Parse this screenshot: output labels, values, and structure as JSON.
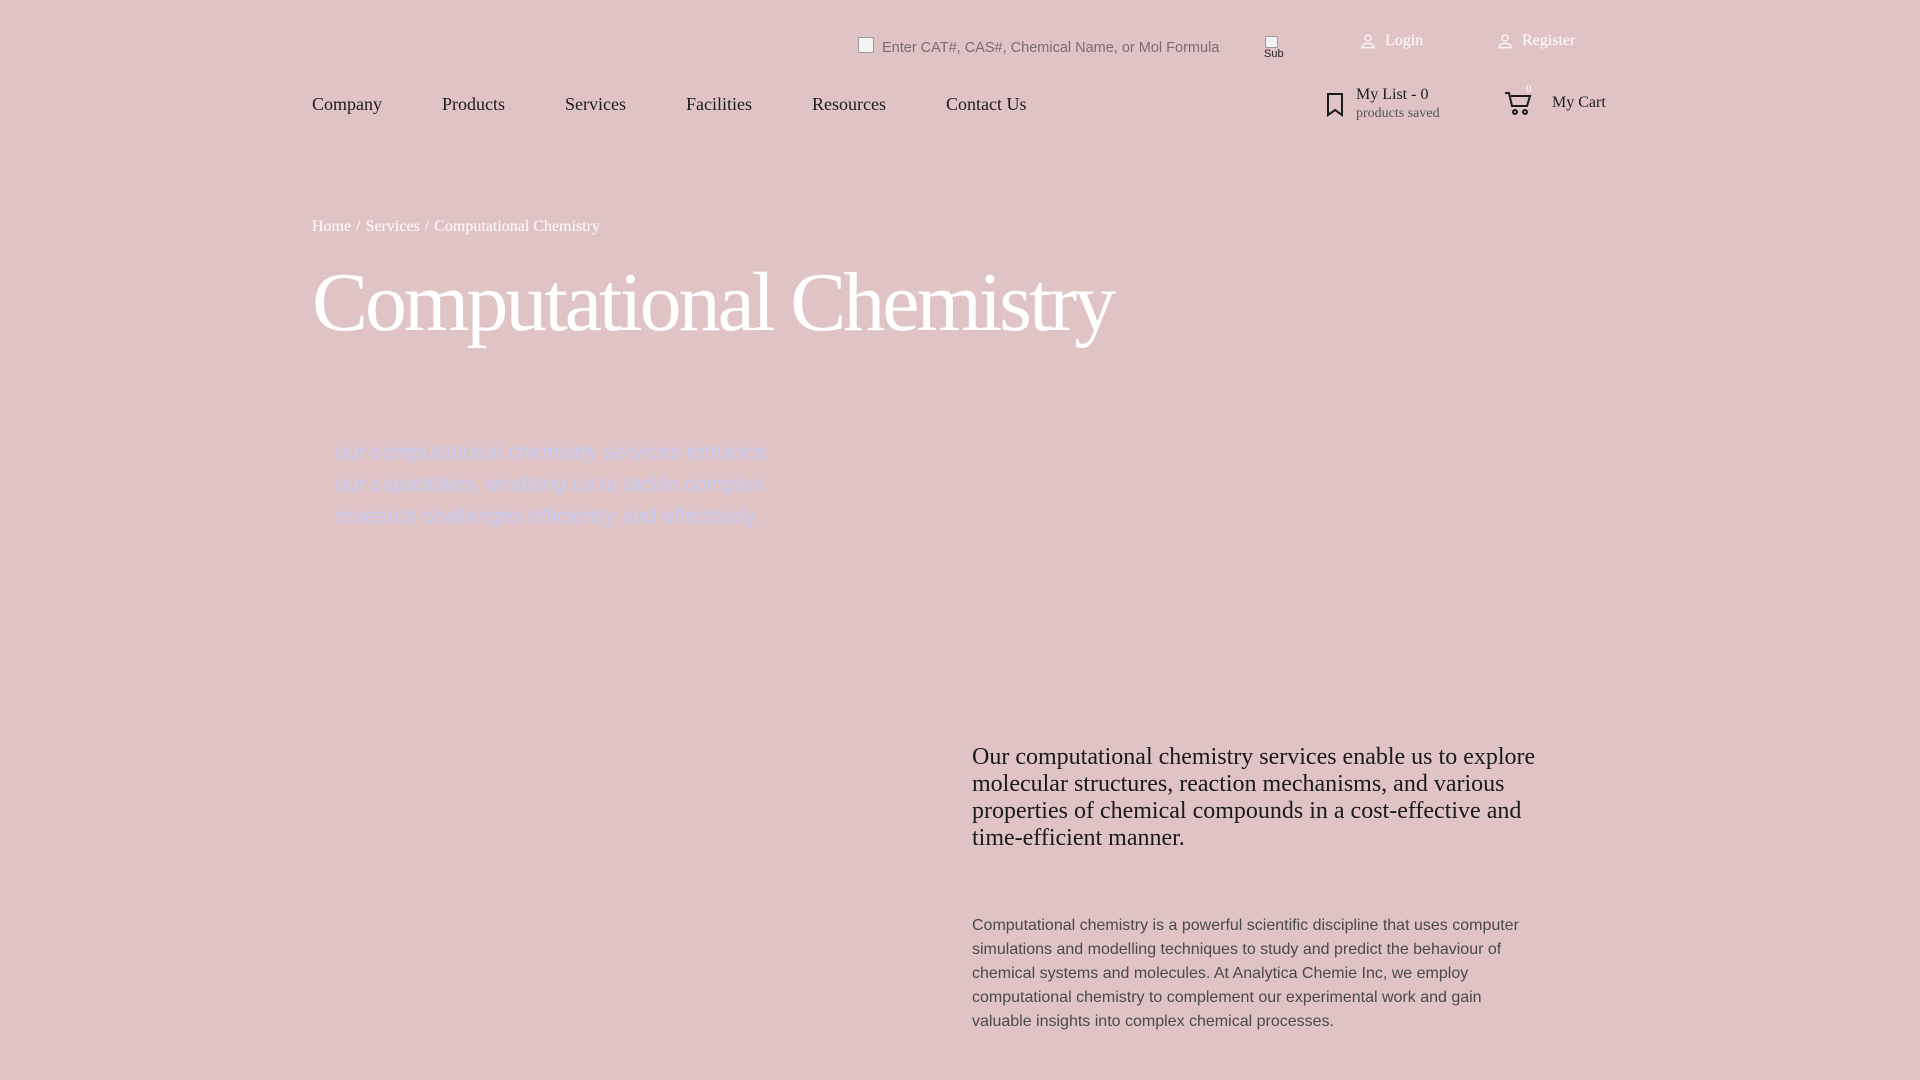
{
  "header": {
    "search": {
      "placeholder": "Enter CAT#, CAS#, Chemical Name, or Mol Formula",
      "value": ""
    },
    "submit_alt": "Sub",
    "login_label": "Login",
    "register_label": "Register"
  },
  "nav": {
    "items": [
      "Company",
      "Products",
      "Services",
      "Facilities",
      "Resources",
      "Contact Us"
    ]
  },
  "my_list": {
    "title": "My List - 0",
    "subtitle": "products saved"
  },
  "cart": {
    "label": "My Cart",
    "count": "0"
  },
  "breadcrumb": {
    "home": "Home",
    "sep": "/",
    "services": "Services",
    "current": "Computational Chemistry"
  },
  "page": {
    "title": "Computational Chemistry",
    "blurb": "our computational chemistry services enhance our capabilities, enabling us to tackle complex research challenges efficiently and effectively.",
    "lead": "Our computational chemistry services enable us to explore molecular structures, reaction mechanisms, and various properties of chemical compounds in a cost-effective and time-efficient manner.",
    "body": "Computational chemistry is a powerful scientific discipline that uses computer simulations and modelling techniques to study and predict the behaviour of chemical systems and molecules. At Analytica Chemie Inc, we employ computational chemistry to complement our experimental work and gain valuable insights into complex chemical processes."
  },
  "colors": {
    "background": "#e0c3c5",
    "blurb": "#c8cbf2",
    "white": "#ffffff"
  }
}
